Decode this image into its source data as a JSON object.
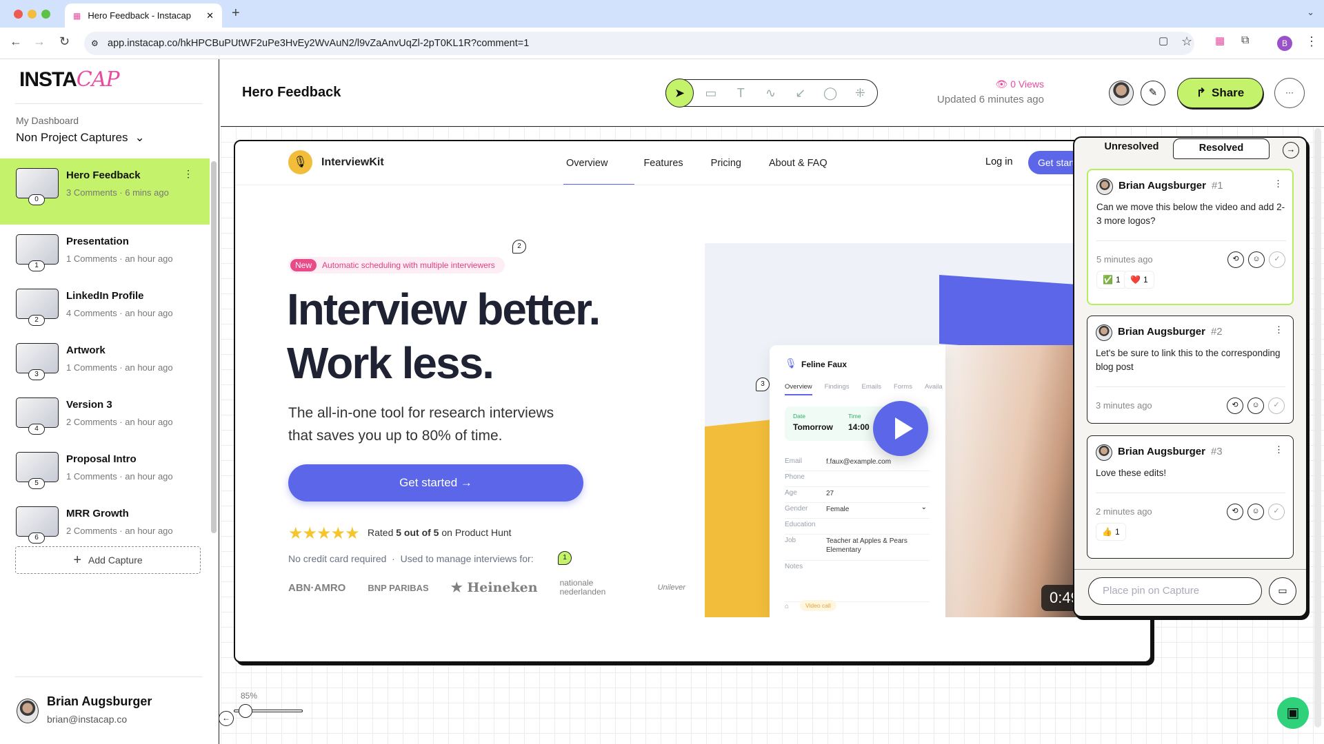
{
  "browser": {
    "tab_title": "Hero Feedback - Instacap",
    "url": "app.instacap.co/hkHPCBuPUtWF2uPe3HvEy2WvAuN2/l9vZaAnvUqZl-2pT0KL1R?comment=1",
    "avatar_letter": "B"
  },
  "sidebar": {
    "logo": "INSTACAP",
    "dashboard_label": "My Dashboard",
    "project_select": "Non Project Captures",
    "items": [
      {
        "title": "Hero Feedback",
        "sub": "3 Comments · 6 mins ago",
        "num": "0"
      },
      {
        "title": "Presentation",
        "sub": "1 Comments · an hour ago",
        "num": "1"
      },
      {
        "title": "LinkedIn Profile",
        "sub": "4 Comments · an hour ago",
        "num": "2"
      },
      {
        "title": "Artwork",
        "sub": "1 Comments · an hour ago",
        "num": "3"
      },
      {
        "title": "Version 3",
        "sub": "2 Comments · an hour ago",
        "num": "4"
      },
      {
        "title": "Proposal Intro",
        "sub": "1 Comments · an hour ago",
        "num": "5"
      },
      {
        "title": "MRR Growth",
        "sub": "2 Comments · an hour ago",
        "num": "6"
      }
    ],
    "add_capture": "Add Capture",
    "user_name": "Brian Augsburger",
    "user_email": "brian@instacap.co"
  },
  "header": {
    "title": "Hero Feedback",
    "views": "0 Views",
    "updated": "Updated 6 minutes ago",
    "share": "Share",
    "more": "···",
    "tools": [
      "cursor-icon",
      "comment-icon",
      "text-icon",
      "draw-icon",
      "arrow-icon",
      "circle-icon",
      "blur-icon"
    ]
  },
  "capture": {
    "brand": "InterviewKit",
    "nav": [
      "Overview",
      "Features",
      "Pricing",
      "About & FAQ"
    ],
    "login": "Log in",
    "get_started_nav": "Get started",
    "badge_new": "New",
    "badge_text": "Automatic scheduling with multiple interviewers",
    "headline1": "Interview better.",
    "headline2": "Work less.",
    "subtitle1": "The all-in-one tool for research interviews",
    "subtitle2": "that saves you up to 80% of time.",
    "cta": "Get started →",
    "rated_pre": "Rated ",
    "rated_bold": "5 out of 5",
    "rated_post": " on Product Hunt",
    "rating": 5,
    "no_credit": "No credit card required  ·  Used to manage interviews for:",
    "logos": [
      "ABN·AMRO",
      "BNP PARIBAS",
      "★ Heineken",
      "nationale nederlanden",
      "Unilever"
    ],
    "card": {
      "name": "Feline Faux",
      "tabs": [
        "Overview",
        "Findings",
        "Emails",
        "Forms",
        "Availa"
      ],
      "date_label": "Date",
      "date": "Tomorrow",
      "time_label": "Time",
      "time": "14:00",
      "fields": [
        {
          "k": "Email",
          "v": "f.faux@example.com"
        },
        {
          "k": "Phone",
          "v": ""
        },
        {
          "k": "Age",
          "v": "27"
        },
        {
          "k": "Gender",
          "v": "Female"
        },
        {
          "k": "Education",
          "v": ""
        },
        {
          "k": "Job",
          "v": "Teacher at Apples & Pears Elementary"
        },
        {
          "k": "Notes",
          "v": ""
        }
      ],
      "tag": "Video call"
    },
    "video_time": "0:49",
    "pins": [
      "1",
      "2",
      "3"
    ]
  },
  "comments": {
    "tab_unresolved": "Unresolved",
    "tab_resolved": "Resolved",
    "placeholder": "Place pin on Capture",
    "items": [
      {
        "author": "Brian Augsburger",
        "num": "#1",
        "text": "Can we move this below the video and add 2-3 more logos?",
        "time": "5 minutes ago",
        "reactions": [
          {
            "emoji": "✅",
            "count": "1"
          },
          {
            "emoji": "❤️",
            "count": "1"
          }
        ],
        "active": true
      },
      {
        "author": "Brian Augsburger",
        "num": "#2",
        "text": "Let's be sure to link this to the corresponding blog post",
        "time": "3 minutes ago",
        "reactions": []
      },
      {
        "author": "Brian Augsburger",
        "num": "#3",
        "text": "Love these edits!",
        "time": "2 minutes ago",
        "reactions": [
          {
            "emoji": "👍",
            "count": "1"
          }
        ]
      }
    ]
  },
  "zoom": {
    "level": "85%",
    "value": 85
  },
  "colors": {
    "accent_green": "#c4f36b",
    "brand_blue": "#5b67e8",
    "pink": "#e94aa0",
    "yellow": "#f2bd3a"
  }
}
